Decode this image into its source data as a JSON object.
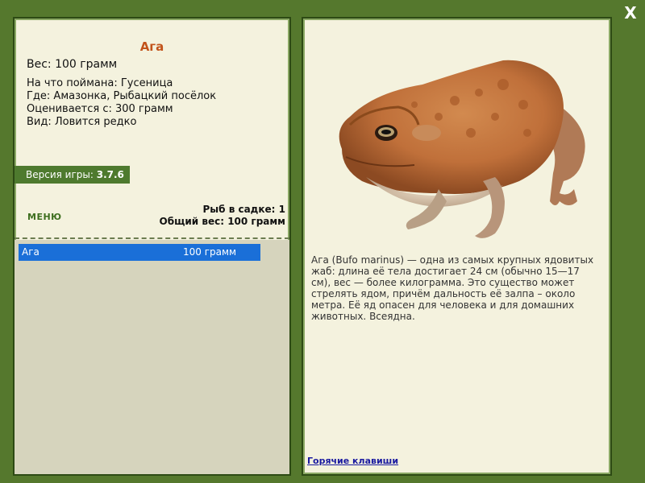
{
  "close_label": "X",
  "fish": {
    "name": "Ага",
    "weight": "Вес: 100 грамм",
    "info": [
      "На что поймана: Гусеница",
      "Где: Амазонка, Рыбацкий посёлок",
      "Оценивается с: 300 грамм",
      "Вид: Ловится редко"
    ],
    "description": "Ага (Bufo marinus) — одна из самых крупных ядовитых жаб: длина её тела достигает 24 см (обычно 15—17 см), вес — более килограмма. Это существо может стрелять ядом, причём дальность её залпа – около метра. Её яд опасен для человека и для домашних животных. Всеядна."
  },
  "version": {
    "label": "Версия игры: ",
    "value": "3.7.6"
  },
  "menu_label": "МЕНЮ",
  "stats": {
    "count": "Рыб в садке: 1",
    "total": "Общий вес: 100 грамм"
  },
  "catch_list": [
    {
      "name": "Ага",
      "weight": "100 грамм"
    }
  ],
  "hotkeys_label": "Горячие клавиши",
  "colors": {
    "background": "#55782d",
    "panel": "#f4f2de",
    "accent_title": "#c2531a",
    "selection": "#1a6fd8"
  },
  "icons": {
    "close": "close-icon"
  }
}
